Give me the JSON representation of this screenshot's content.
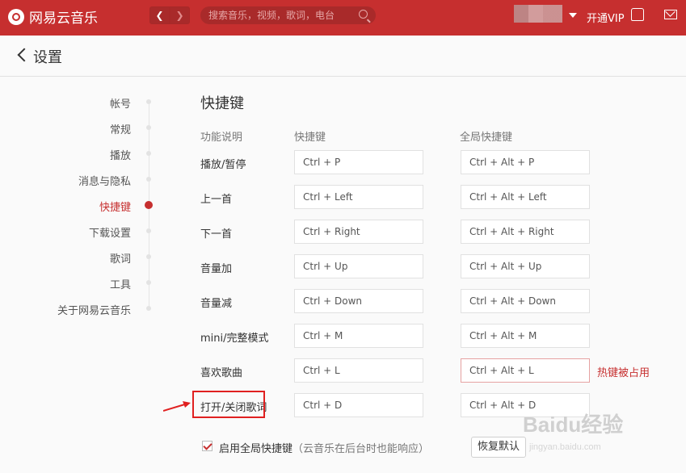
{
  "app": {
    "name": "网易云音乐",
    "search_placeholder": "搜索音乐，视频，歌词，电台",
    "vip_label": "开通VIP"
  },
  "page": {
    "title": "设置",
    "section_title": "快捷键"
  },
  "sidebar": {
    "items": [
      {
        "label": "帐号"
      },
      {
        "label": "常规"
      },
      {
        "label": "播放"
      },
      {
        "label": "消息与隐私"
      },
      {
        "label": "快捷键",
        "active": true
      },
      {
        "label": "下载设置"
      },
      {
        "label": "歌词"
      },
      {
        "label": "工具"
      },
      {
        "label": "关于网易云音乐"
      }
    ]
  },
  "table": {
    "headers": {
      "func": "功能说明",
      "key": "快捷键",
      "global": "全局快捷键"
    },
    "rows": [
      {
        "label": "播放/暂停",
        "key": "Ctrl + P",
        "global": "Ctrl + Alt + P"
      },
      {
        "label": "上一首",
        "key": "Ctrl + Left",
        "global": "Ctrl + Alt + Left"
      },
      {
        "label": "下一首",
        "key": "Ctrl + Right",
        "global": "Ctrl + Alt + Right"
      },
      {
        "label": "音量加",
        "key": "Ctrl + Up",
        "global": "Ctrl + Alt + Up"
      },
      {
        "label": "音量减",
        "key": "Ctrl + Down",
        "global": "Ctrl + Alt + Down"
      },
      {
        "label": "mini/完整模式",
        "key": "Ctrl + M",
        "global": "Ctrl + Alt + M"
      },
      {
        "label": "喜欢歌曲",
        "key": "Ctrl + L",
        "global": "Ctrl + Alt + L",
        "conflict": "热键被占用"
      },
      {
        "label": "打开/关闭歌词",
        "key": "Ctrl + D",
        "global": "Ctrl + Alt + D"
      }
    ]
  },
  "footer": {
    "checkbox_label": "启用全局快捷键",
    "checkbox_note": "（云音乐在后台时也能响应）",
    "reset_label": "恢复默认"
  },
  "watermark": {
    "main": "Baidu经验",
    "sub": "jingyan.baidu.com"
  },
  "colors": {
    "brand": "#c62f2f",
    "conflict": "#c62f2f"
  }
}
